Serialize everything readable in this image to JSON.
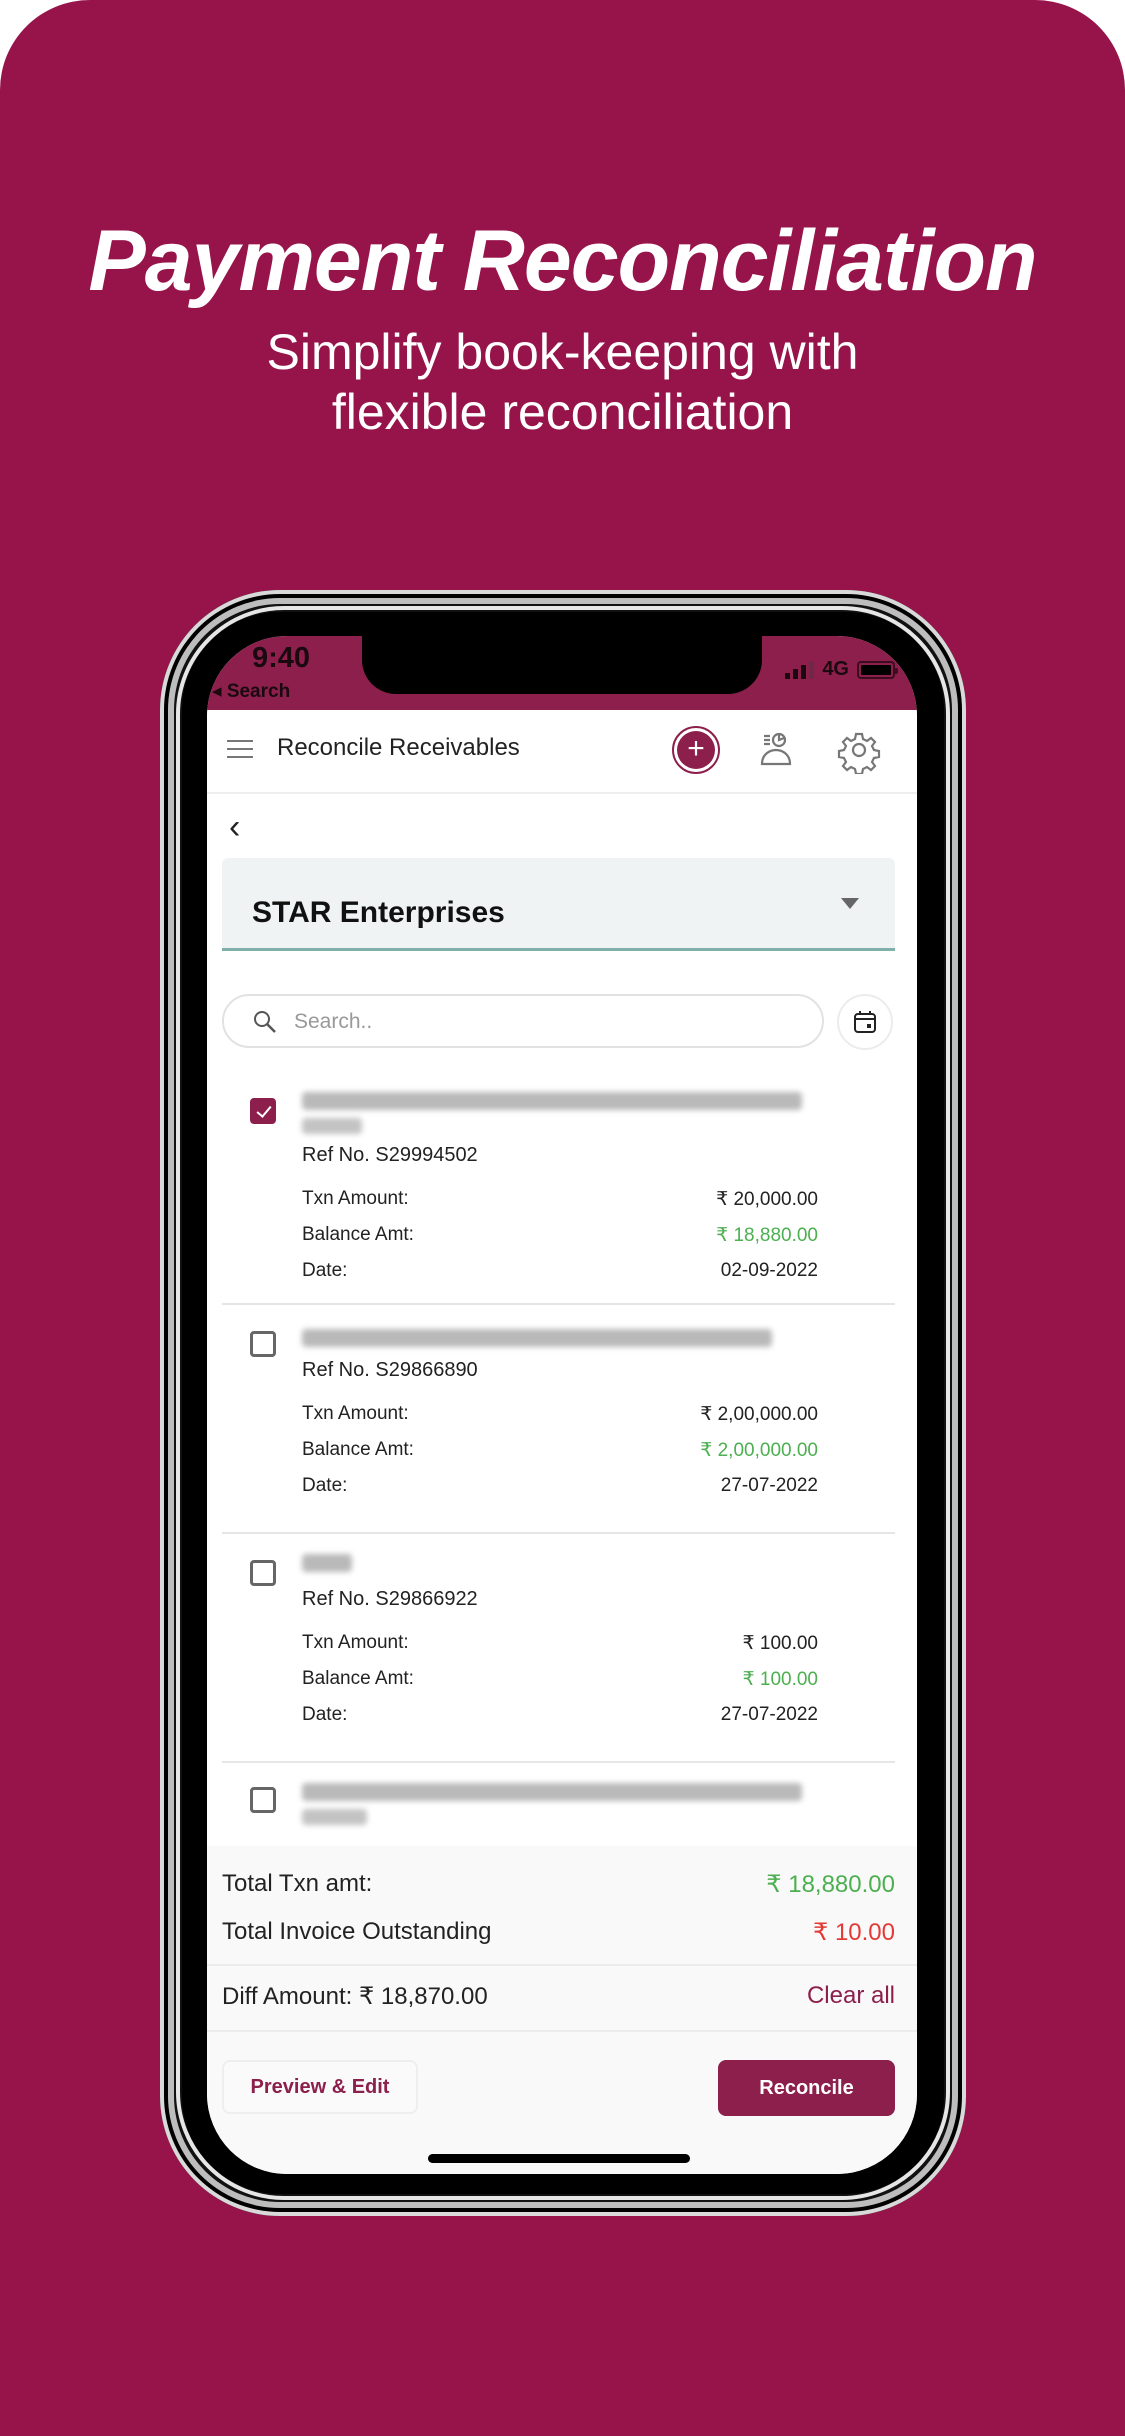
{
  "promo": {
    "headline": "Payment Reconciliation",
    "subline_1": "Simplify book-keeping with",
    "subline_2": "flexible reconciliation",
    "background_color": "#97144b"
  },
  "status_bar": {
    "time": "9:40",
    "back_label": "◂ Search",
    "network": "4G"
  },
  "app_bar": {
    "title": "Reconcile Receivables",
    "icons": [
      "menu-icon",
      "add-icon",
      "customer-report-icon",
      "settings-icon"
    ]
  },
  "party_select": {
    "selected": "STAR Enterprises"
  },
  "search": {
    "placeholder": "Search..",
    "value": ""
  },
  "labels": {
    "txn_amount": "Txn Amount:",
    "balance_amt": "Balance Amt:",
    "date": "Date:"
  },
  "transactions": [
    {
      "checked": true,
      "description": "(blurred)",
      "ref": "Ref No. S29994502",
      "txn_amount": "₹ 20,000.00",
      "balance_amt": "₹ 18,880.00",
      "date": "02-09-2022"
    },
    {
      "checked": false,
      "description": "(blurred)",
      "ref": "Ref No. S29866890",
      "txn_amount": "₹ 2,00,000.00",
      "balance_amt": "₹ 2,00,000.00",
      "date": "27-07-2022"
    },
    {
      "checked": false,
      "description": "(blurred)",
      "ref": "Ref No. S29866922",
      "txn_amount": "₹ 100.00",
      "balance_amt": "₹ 100.00",
      "date": "27-07-2022"
    },
    {
      "checked": false,
      "description": "(blurred)"
    }
  ],
  "summary": {
    "total_txn_label": "Total Txn amt:",
    "total_txn_value": "₹ 18,880.00",
    "total_invoice_label": "Total Invoice Outstanding",
    "total_invoice_value": "₹ 10.00",
    "diff_label": "Diff Amount: ₹ 18,870.00",
    "clear_all": "Clear all"
  },
  "actions": {
    "preview_edit": "Preview & Edit",
    "reconcile": "Reconcile"
  },
  "colors": {
    "brand": "#8c1f4b",
    "positive": "#4caf50",
    "negative": "#e53935"
  }
}
